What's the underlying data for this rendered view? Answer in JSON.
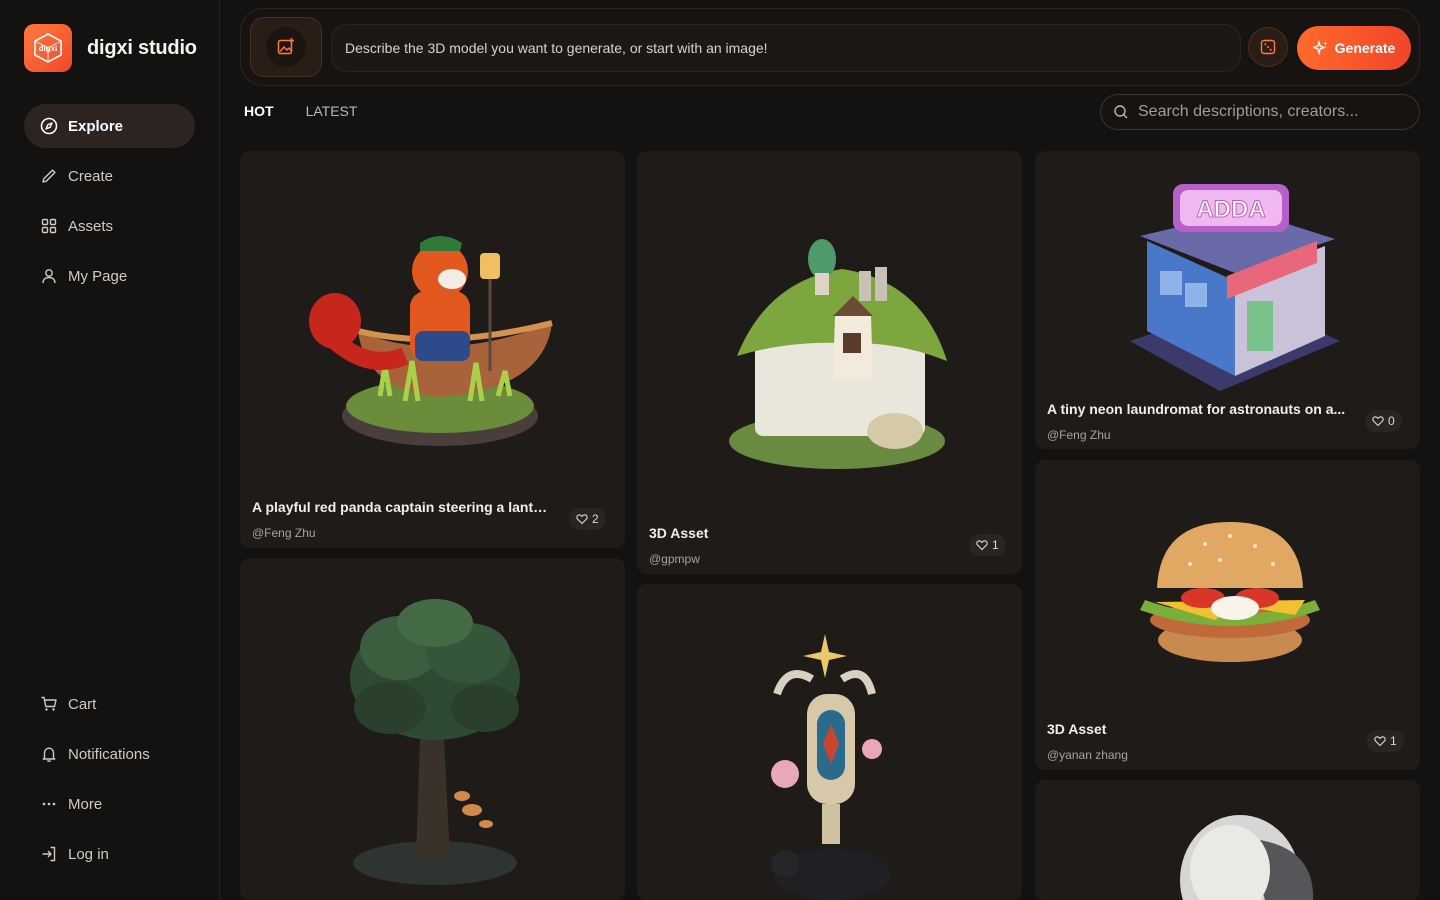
{
  "brand": {
    "name": "digxi studio",
    "mark_text": "digxi",
    "accent": "#ff6a2b"
  },
  "nav": {
    "items": [
      {
        "label": "Explore",
        "icon": "compass-icon",
        "active": true
      },
      {
        "label": "Create",
        "icon": "pencil-icon",
        "active": false
      },
      {
        "label": "Assets",
        "icon": "grid-icon",
        "active": false
      },
      {
        "label": "My Page",
        "icon": "user-icon",
        "active": false
      }
    ],
    "bottom": [
      {
        "label": "Cart",
        "icon": "cart-icon"
      },
      {
        "label": "Notifications",
        "icon": "bell-icon"
      },
      {
        "label": "More",
        "icon": "more-icon"
      },
      {
        "label": "Log in",
        "icon": "login-icon"
      }
    ]
  },
  "prompt": {
    "placeholder": "Describe the 3D model you want to generate, or start with an image!",
    "generate_label": "Generate"
  },
  "tabs": [
    {
      "label": "HOT",
      "active": true
    },
    {
      "label": "LATEST",
      "active": false
    }
  ],
  "search": {
    "placeholder": "Search descriptions, creators..."
  },
  "cards": [
    {
      "title": "A playful red panda captain steering a lanter...",
      "user": "@Feng Zhu",
      "likes": "2",
      "subject": "red panda in boat"
    },
    {
      "title": "3D Asset",
      "user": "@gpmpw",
      "likes": "1",
      "subject": "mossy cottage"
    },
    {
      "title": "A tiny neon laundromat for astronauts on a...",
      "user": "@Feng Zhu",
      "likes": "0",
      "subject": "neon laundromat"
    },
    {
      "title": "3D Asset",
      "user": "@yanan zhang",
      "likes": "1",
      "subject": "burger"
    },
    {
      "subject": "tree on rocks"
    },
    {
      "subject": "shrine with panther"
    },
    {
      "subject": "helmet"
    }
  ]
}
